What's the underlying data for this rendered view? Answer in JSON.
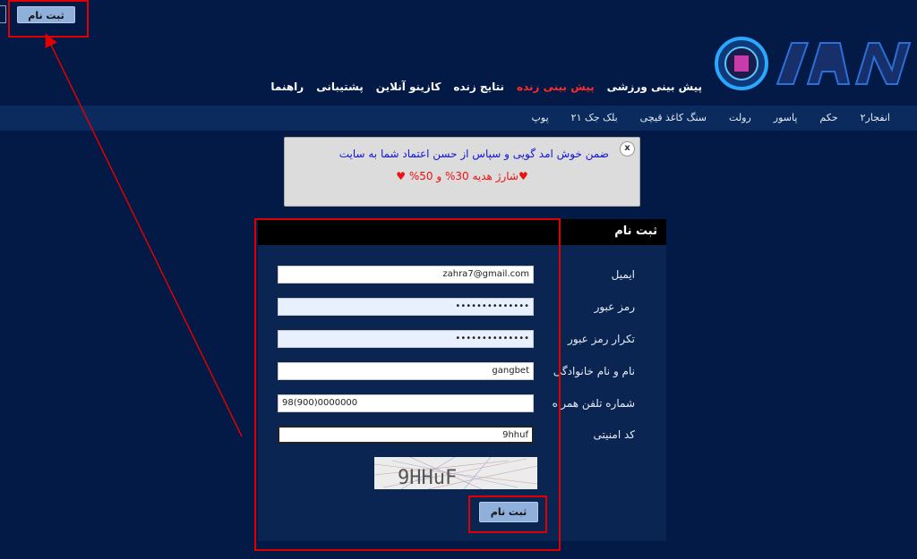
{
  "top_button": {
    "label": "ثبت نام"
  },
  "main_nav": {
    "items": [
      "پیش بینی ورزشی",
      "پیش بینی زنده",
      "نتایج زنده",
      "کازینو آنلاین",
      "پشتیبانی",
      "راهنما"
    ],
    "active_index": 1
  },
  "sub_nav": {
    "items": [
      "انفجار۲",
      "حکم",
      "پاسور",
      "رولت",
      "سنگ کاغذ قیچی",
      "بلک جک ۲۱",
      "پوپ"
    ]
  },
  "alert": {
    "close_label": "x",
    "line1": "ضمن خوش امد گویی و سپاس از حسن اعتماد شما به سایت",
    "line2": "♥شارژ هدیه 30% و 50% ♥"
  },
  "form": {
    "title": "ثبت نام",
    "fields": [
      {
        "label": "ایمیل",
        "value": "zahra7@gmail.com"
      },
      {
        "label": "رمز عبور",
        "value": "••••••••••••••"
      },
      {
        "label": "تکرار رمز عبور",
        "value": "••••••••••••••"
      },
      {
        "label": "نام و نام خانوادگی",
        "value": "gangbet"
      },
      {
        "label": "شماره تلفن همراه",
        "value": "98(900)0000000"
      },
      {
        "label": "کد امنیتی",
        "value": "9hhuf"
      }
    ],
    "captcha_text": "9HHuF",
    "submit_label": "ثبت نام"
  },
  "colors": {
    "background": "#021a45",
    "accent": "#8fb0da",
    "active_nav": "#ff2a2a",
    "highlight": "#e00000"
  }
}
